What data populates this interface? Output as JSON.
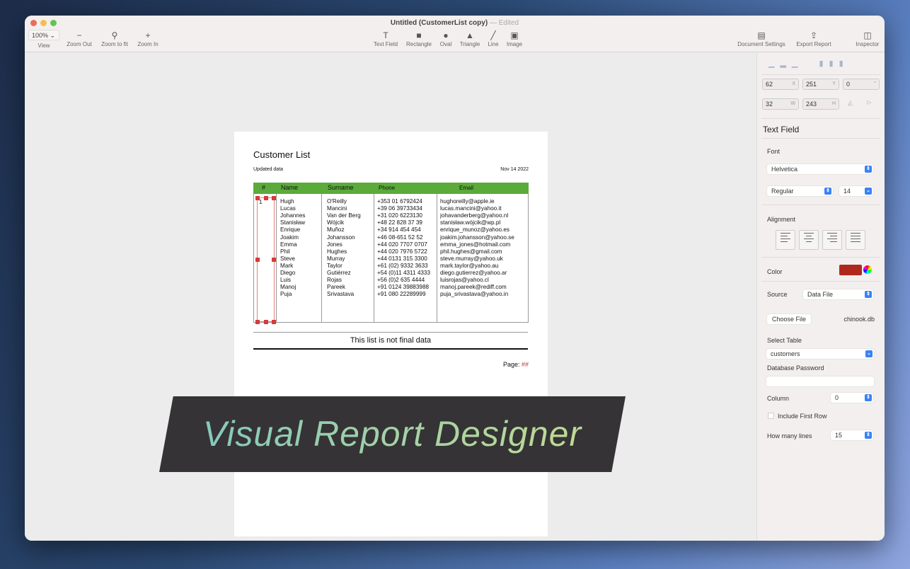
{
  "window": {
    "title": "Untitled (CustomerList copy)",
    "status": "— Edited"
  },
  "toolbar": {
    "zoom": "100% ⌄",
    "view": "View",
    "zoom_out": "Zoom Out",
    "zoom_fit": "Zoom to fit",
    "zoom_in": "Zoom In",
    "tools": [
      {
        "label": "Text Field",
        "icon": "T"
      },
      {
        "label": "Rectangle",
        "icon": "■"
      },
      {
        "label": "Oval",
        "icon": "●"
      },
      {
        "label": "Triangle",
        "icon": "▲"
      },
      {
        "label": "Line",
        "icon": "╱"
      },
      {
        "label": "Image",
        "icon": "▣"
      }
    ],
    "doc_settings": "Document Settings",
    "export": "Export Report",
    "inspector": "Inspector"
  },
  "report": {
    "title": "Customer List",
    "subtitle": "Updated data",
    "date": "Nov 14 2022",
    "headers": [
      "#",
      "Name",
      "Surname",
      "Phone",
      "Email"
    ],
    "row_marker": "1",
    "rows": [
      [
        "Hugh",
        "O'Reilly",
        "+353 01 6792424",
        "hughoreilly@apple.ie"
      ],
      [
        "Lucas",
        "Mancini",
        "+39 06 39733434",
        "lucas.mancini@yahoo.it"
      ],
      [
        "Johannes",
        "Van der Berg",
        "+31 020 6223130",
        "johavanderberg@yahoo.nl"
      ],
      [
        "Stanisław",
        "Wójcik",
        "+48 22 828 37 39",
        "stanisław.wójcik@wp.pl"
      ],
      [
        "Enrique",
        "Muñoz",
        "+34 914 454 454",
        "enrique_munoz@yahoo.es"
      ],
      [
        "Joakim",
        "Johansson",
        "+46 08-651 52 52",
        "joakim.johansson@yahoo.se"
      ],
      [
        "Emma",
        "Jones",
        "+44 020 7707 0707",
        "emma_jones@hotmail.com"
      ],
      [
        "Phil",
        "Hughes",
        "+44 020 7976 5722",
        "phil.hughes@gmail.com"
      ],
      [
        "Steve",
        "Murray",
        "+44 0131 315 3300",
        "steve.murray@yahoo.uk"
      ],
      [
        "Mark",
        "Taylor",
        "+61 (02) 9332 3633",
        "mark.taylor@yahoo.au"
      ],
      [
        "Diego",
        "Gutiérrez",
        "+54 (0)11 4311 4333",
        "diego.gutierrez@yahoo.ar"
      ],
      [
        "Luis",
        "Rojas",
        "+56 (0)2 635 4444",
        "luisrojas@yahoo.cl"
      ],
      [
        "Manoj",
        "Pareek",
        "+91 0124 39883988",
        "manoj.pareek@rediff.com"
      ],
      [
        "Puja",
        "Srivastava",
        "+91 080 22289999",
        "puja_srivastava@yahoo.in"
      ]
    ],
    "note": "This list is not final data",
    "page_label": "Page:",
    "page_value": "##"
  },
  "inspector": {
    "x": "62",
    "y": "251",
    "angle": "0",
    "w": "32",
    "h": "243",
    "x_unit": "X",
    "y_unit": "Y",
    "angle_unit": "°",
    "w_unit": "W",
    "h_unit": "H",
    "section": "Text Field",
    "font_label": "Font",
    "font": "Helvetica",
    "style": "Regular",
    "size": "14",
    "alignment_label": "Alignment",
    "color_label": "Color",
    "color": "#b0281c",
    "source_label": "Source",
    "source": "Data File",
    "choose_file": "Choose File",
    "file": "chinook.db",
    "table_label": "Select Table",
    "table": "customers",
    "password_label": "Database Password",
    "password": "",
    "column_label": "Column",
    "column": "0",
    "include_first_row": "Include First Row",
    "lines_label": "How many lines",
    "lines": "15"
  },
  "banner": {
    "text": "Visual Report Designer"
  }
}
